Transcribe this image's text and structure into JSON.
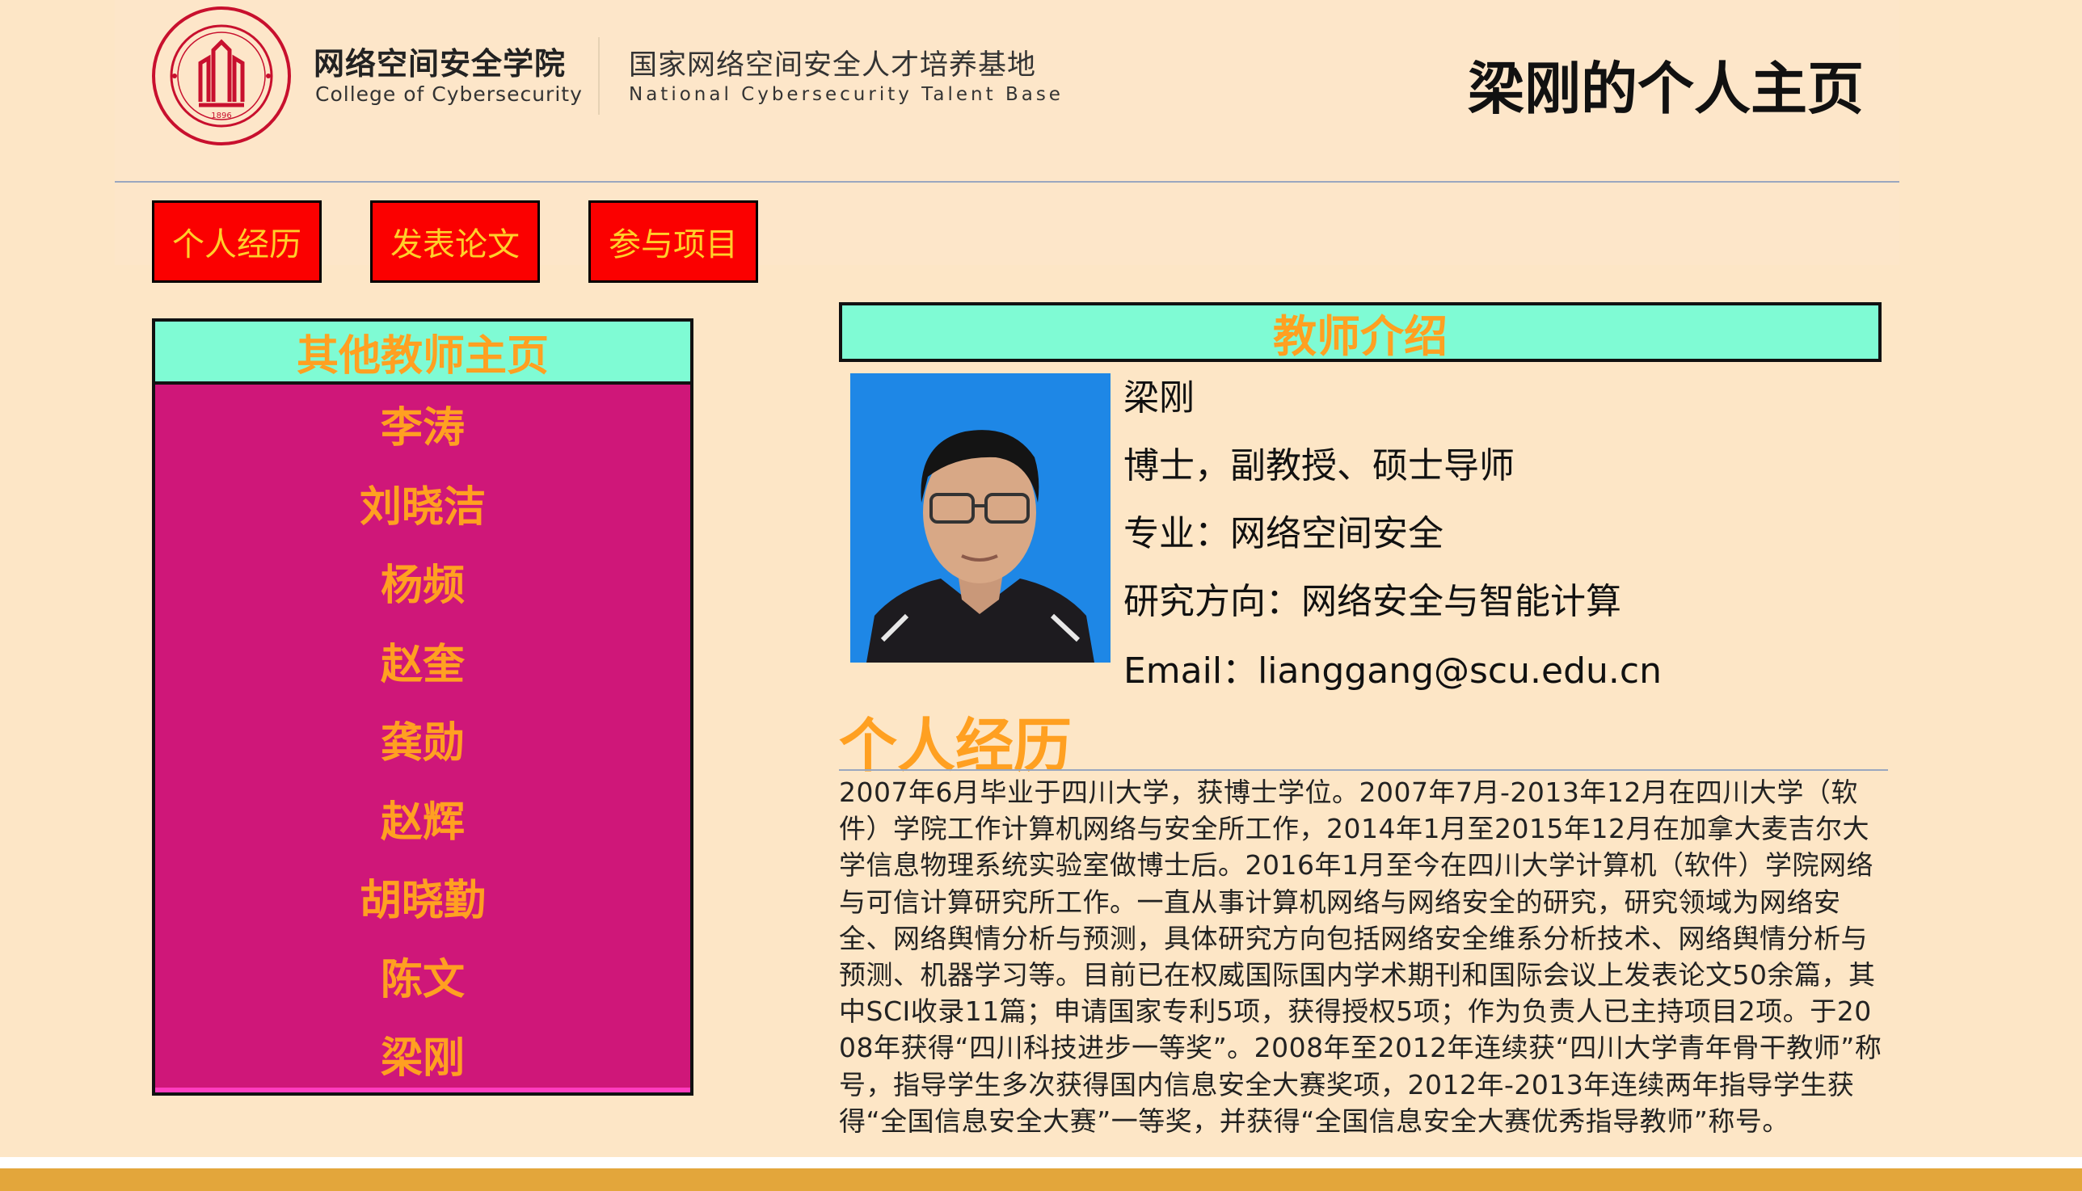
{
  "header": {
    "college_cn": "网络空间安全学院",
    "college_en": "College of Cybersecurity",
    "base_cn": "国家网络空间安全人才培养基地",
    "base_en": "National Cybersecurity Talent Base",
    "page_title": "梁刚的个人主页"
  },
  "nav": {
    "items": [
      "个人经历",
      "发表论文",
      "参与项目"
    ]
  },
  "sidebar": {
    "title": "其他教师主页",
    "teachers": [
      "李涛",
      "刘晓洁",
      "杨频",
      "赵奎",
      "龚勋",
      "赵辉",
      "胡晓勤",
      "陈文",
      "梁刚"
    ]
  },
  "intro": {
    "title": "教师介绍",
    "name": "梁刚",
    "degree": "博士，副教授、硕士导师",
    "major": "专业：网络空间安全",
    "research": "研究方向：网络安全与智能计算",
    "email": "Email：lianggang@scu.edu.cn"
  },
  "experience": {
    "title": "个人经历",
    "text": "2007年6月毕业于四川大学，获博士学位。2007年7月-2013年12月在四川大学（软件）学院工作计算机网络与安全所工作，2014年1月至2015年12月在加拿大麦吉尔大学信息物理系统实验室做博士后。2016年1月至今在四川大学计算机（软件）学院网络与可信计算研究所工作。一直从事计算机网络与网络安全的研究，研究领域为网络安全、网络舆情分析与预测，具体研究方向包括网络安全维系分析技术、网络舆情分析与预测、机器学习等。目前已在权威国际国内学术期刊和国际会议上发表论文50余篇，其中SCI收录11篇；申请国家专利5项，获得授权5项；作为负责人已主持项目2项。于2008年获得“四川科技进步一等奖”。2008年至2012年连续获“四川大学青年骨干教师”称号，指导学生多次获得国内信息安全大赛奖项，2012年-2013年连续两年指导学生获得“全国信息安全大赛”一等奖，并获得“全国信息安全大赛优秀指导教师”称号。"
  },
  "colors": {
    "page_bg": "#fde6c6",
    "nav_button": "#fb0000",
    "nav_text": "#ffcf2a",
    "sidebar_bg": "#cf1779",
    "header_teal": "#7ffbd4",
    "accent_orange": "#ffa021",
    "footer": "#e3a63b"
  }
}
